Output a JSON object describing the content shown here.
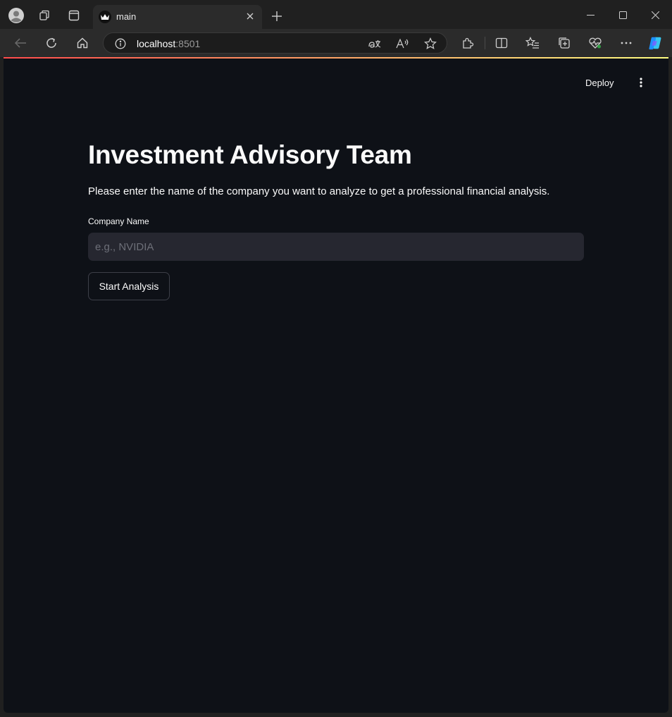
{
  "browser": {
    "tab_title": "main",
    "url_host": "localhost",
    "url_port": ":8501"
  },
  "app": {
    "deploy_label": "Deploy",
    "title": "Investment Advisory Team",
    "description": "Please enter the name of the company you want to analyze to get a professional financial analysis.",
    "company_field": {
      "label": "Company Name",
      "value": "",
      "placeholder": "e.g., NVIDIA"
    },
    "start_button": "Start Analysis"
  },
  "colors": {
    "app_background": "#0e1117",
    "input_background": "#262730",
    "text": "#fafafa",
    "accent_gradient_start": "#ff4b4b",
    "accent_gradient_end": "#fffd80"
  }
}
